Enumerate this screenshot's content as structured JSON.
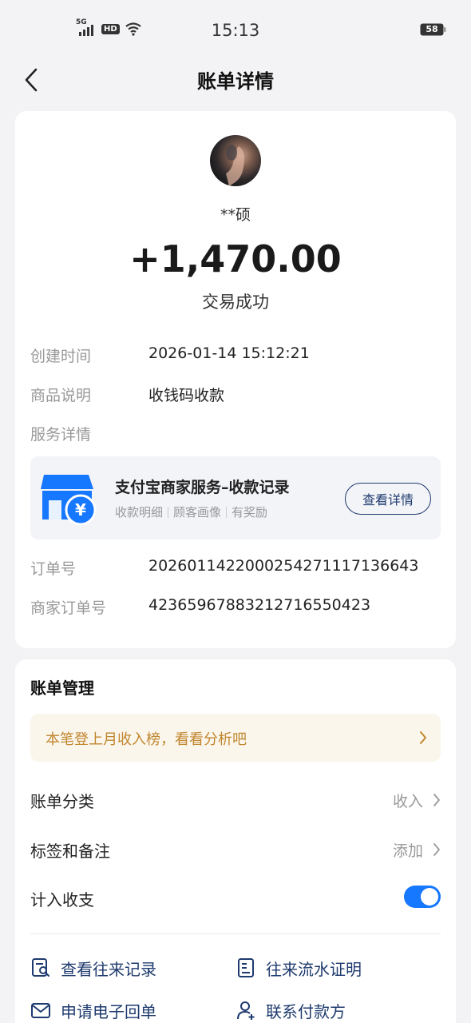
{
  "status_bar": {
    "network": "5G",
    "hd": "HD",
    "time": "15:13",
    "battery": "58"
  },
  "nav": {
    "title": "账单详情"
  },
  "transaction": {
    "payer": "**硕",
    "amount": "+1,470.00",
    "status": "交易成功"
  },
  "details": {
    "created_label": "创建时间",
    "created_value": "2026-01-14 15:12:21",
    "goods_label": "商品说明",
    "goods_value": "收钱码收款",
    "service_label": "服务详情",
    "order_label": "订单号",
    "order_value": "2026011422000254271117136643",
    "merchant_order_label": "商家订单号",
    "merchant_order_value": "4236596788321271655042​3"
  },
  "service": {
    "title": "支付宝商家服务–收款记录",
    "sub1": "收款明细",
    "sub2": "顾客画像",
    "sub3": "有奖励",
    "button": "查看详情"
  },
  "management": {
    "title": "账单管理",
    "promo": "本笔登上月收入榜，看看分析吧",
    "category_label": "账单分类",
    "category_value": "收入",
    "tags_label": "标签和备注",
    "tags_value": "添加",
    "include_label": "计入收支",
    "include_on": true
  },
  "actions": {
    "records": "查看往来记录",
    "proof": "往来流水证明",
    "receipt": "申请电子回单",
    "contact": "联系付款方"
  },
  "colors": {
    "accent_blue": "#1677ff",
    "link_navy": "#1e3a6e",
    "promo_text": "#c0862e"
  }
}
